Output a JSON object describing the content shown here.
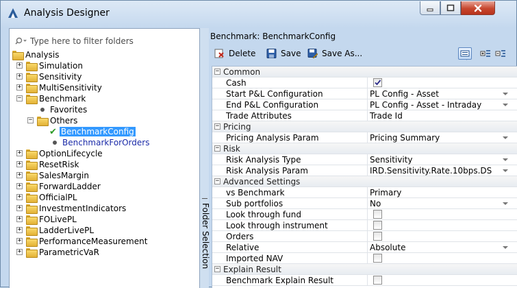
{
  "window": {
    "title": "Analysis Designer",
    "minimize_icon": "minimize-icon",
    "maximize_icon": "maximize-icon",
    "close_icon": "close-icon"
  },
  "left_panel": {
    "filter_placeholder": "Type here to filter folders",
    "vertical_tab_label": "Folder Selection",
    "tree": [
      {
        "label": "Analysis",
        "type": "folder",
        "level": 0,
        "expander": ""
      },
      {
        "label": "Simulation",
        "type": "folder",
        "level": 1,
        "expander": "+"
      },
      {
        "label": "Sensitivity",
        "type": "folder",
        "level": 1,
        "expander": "+"
      },
      {
        "label": "MultiSensitivity",
        "type": "folder",
        "level": 1,
        "expander": "+"
      },
      {
        "label": "Benchmark",
        "type": "folder",
        "level": 1,
        "expander": "-"
      },
      {
        "label": "Favorites",
        "type": "bullet",
        "level": 2,
        "expander": ""
      },
      {
        "label": "Others",
        "type": "folder",
        "level": 2,
        "expander": "-"
      },
      {
        "label": "BenchmarkConfig",
        "type": "check",
        "level": 3,
        "expander": "",
        "selected": true
      },
      {
        "label": "BenchmarkForOrders",
        "type": "bullet",
        "level": 3,
        "expander": ""
      },
      {
        "label": "OptionLifecycle",
        "type": "folder",
        "level": 1,
        "expander": "+"
      },
      {
        "label": "ResetRisk",
        "type": "folder",
        "level": 1,
        "expander": "+"
      },
      {
        "label": "SalesMargin",
        "type": "folder",
        "level": 1,
        "expander": "+"
      },
      {
        "label": "ForwardLadder",
        "type": "folder",
        "level": 1,
        "expander": "+"
      },
      {
        "label": "OfficialPL",
        "type": "folder",
        "level": 1,
        "expander": "+"
      },
      {
        "label": "InvestmentIndicators",
        "type": "folder",
        "level": 1,
        "expander": "+"
      },
      {
        "label": "FOLivePL",
        "type": "folder",
        "level": 1,
        "expander": "+"
      },
      {
        "label": "LadderLivePL",
        "type": "folder",
        "level": 1,
        "expander": "+"
      },
      {
        "label": "PerformanceMeasurement",
        "type": "folder",
        "level": 1,
        "expander": "+"
      },
      {
        "label": "ParametricVaR",
        "type": "folder",
        "level": 1,
        "expander": "+"
      }
    ]
  },
  "right_panel": {
    "header": "Benchmark: BenchmarkConfig",
    "toolbar": {
      "delete_label": "Delete",
      "save_label": "Save",
      "save_as_label": "Save As..."
    },
    "properties": [
      {
        "kind": "section",
        "label": "Common"
      },
      {
        "kind": "check",
        "label": "Cash",
        "checked": true
      },
      {
        "kind": "dropdown",
        "label": "Start P&L Configuration",
        "value": "PL Config - Asset"
      },
      {
        "kind": "dropdown",
        "label": "End P&L Configuration",
        "value": "PL Config - Asset - Intraday"
      },
      {
        "kind": "text",
        "label": "Trade Attributes",
        "value": "Trade Id"
      },
      {
        "kind": "section",
        "label": "Pricing"
      },
      {
        "kind": "dropdown",
        "label": "Pricing Analysis Param",
        "value": "Pricing Summary"
      },
      {
        "kind": "section",
        "label": "Risk"
      },
      {
        "kind": "dropdown",
        "label": "Risk Analysis Type",
        "value": "Sensitivity"
      },
      {
        "kind": "dropdown",
        "label": "Risk Analysis Param",
        "value": "IRD.Sensitivity.Rate.10bps.DS"
      },
      {
        "kind": "section",
        "label": "Advanced Settings"
      },
      {
        "kind": "text",
        "label": "vs Benchmark",
        "value": "Primary"
      },
      {
        "kind": "dropdown",
        "label": "Sub portfolios",
        "value": "No"
      },
      {
        "kind": "check",
        "label": "Look through fund",
        "checked": false
      },
      {
        "kind": "check",
        "label": "Look through instrument",
        "checked": false
      },
      {
        "kind": "check",
        "label": "Orders",
        "checked": false
      },
      {
        "kind": "dropdown",
        "label": "Relative",
        "value": "Absolute"
      },
      {
        "kind": "check",
        "label": "Imported NAV",
        "checked": false
      },
      {
        "kind": "section",
        "label": "Explain Result"
      },
      {
        "kind": "check",
        "label": "Benchmark Explain Result",
        "checked": false
      }
    ]
  }
}
